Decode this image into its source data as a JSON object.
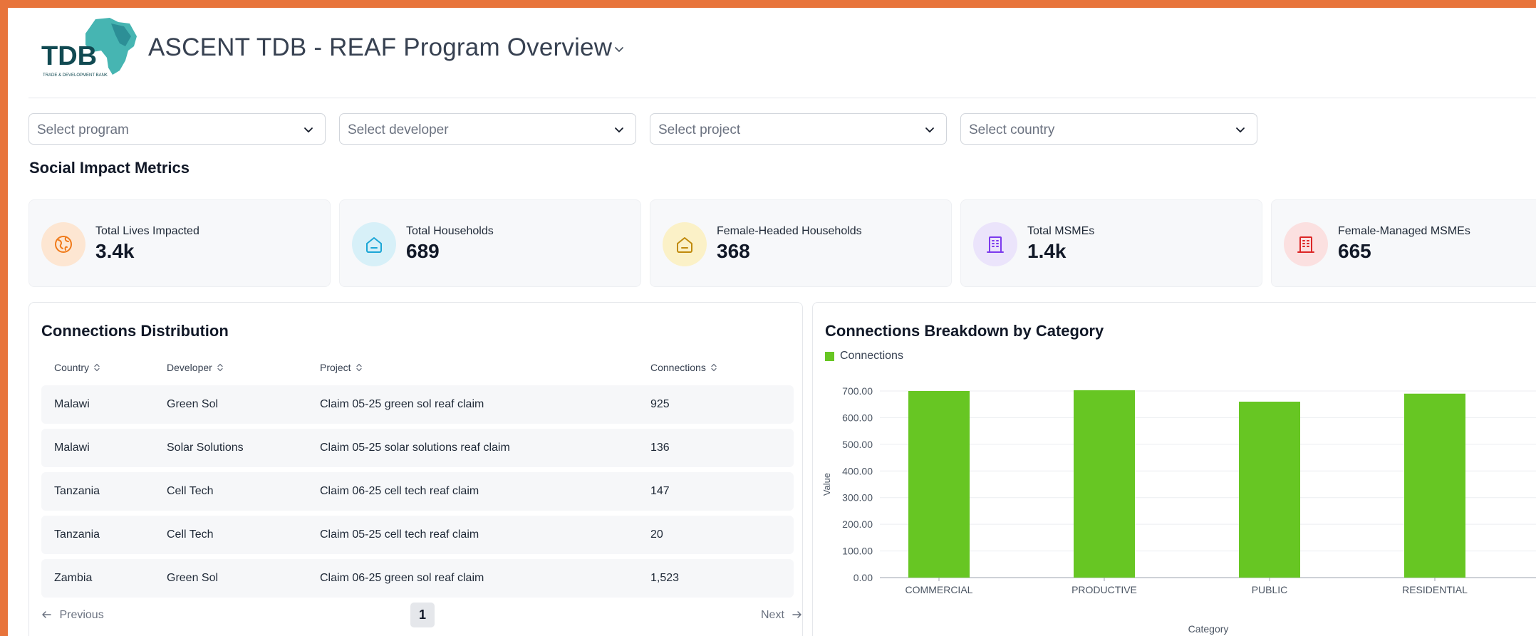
{
  "header": {
    "logo_text": "TDB",
    "logo_subtext": "TRADE & DEVELOPMENT BANK",
    "title": "ASCENT TDB - REAF Program Overview"
  },
  "filters": [
    {
      "placeholder": "Select program"
    },
    {
      "placeholder": "Select developer"
    },
    {
      "placeholder": "Select project"
    },
    {
      "placeholder": "Select country"
    }
  ],
  "section_title": "Social Impact Metrics",
  "metrics": [
    {
      "label": "Total Lives Impacted",
      "value": "3.4k",
      "icon": "globe-icon",
      "bg": "#fde6d2",
      "color": "#f07a1a"
    },
    {
      "label": "Total Households",
      "value": "689",
      "icon": "home-icon",
      "bg": "#d7f0f8",
      "color": "#1ba6d6"
    },
    {
      "label": "Female-Headed Households",
      "value": "368",
      "icon": "home-icon",
      "bg": "#fbf1c7",
      "color": "#c08a0c"
    },
    {
      "label": "Total MSMEs",
      "value": "1.4k",
      "icon": "building-icon",
      "bg": "#ebe4fb",
      "color": "#7c3aed"
    },
    {
      "label": "Female-Managed MSMEs",
      "value": "665",
      "icon": "building-icon",
      "bg": "#fbe0e0",
      "color": "#dc2626"
    }
  ],
  "connections_table": {
    "title": "Connections Distribution",
    "columns": [
      "Country",
      "Developer",
      "Project",
      "Connections"
    ],
    "rows": [
      [
        "Malawi",
        "Green Sol",
        "Claim 05-25 green sol reaf claim",
        "925"
      ],
      [
        "Malawi",
        "Solar Solutions",
        "Claim 05-25 solar solutions reaf claim",
        "136"
      ],
      [
        "Tanzania",
        "Cell Tech",
        "Claim 06-25 cell tech reaf claim",
        "147"
      ],
      [
        "Tanzania",
        "Cell Tech",
        "Claim 05-25 cell tech reaf claim",
        "20"
      ],
      [
        "Zambia",
        "Green Sol",
        "Claim 06-25 green sol reaf claim",
        "1,523"
      ]
    ],
    "pager": {
      "prev": "Previous",
      "next": "Next",
      "page": "1"
    }
  },
  "chart_data": {
    "type": "bar",
    "title": "Connections Breakdown by Category",
    "categories": [
      "COMMERCIAL",
      "PRODUCTIVE",
      "PUBLIC",
      "RESIDENTIAL"
    ],
    "series": [
      {
        "name": "Connections",
        "values": [
          700,
          703,
          660,
          690
        ]
      }
    ],
    "xlabel": "Category",
    "ylabel": "Value",
    "ylim": [
      0,
      700
    ],
    "yticks": [
      "0.00",
      "100.00",
      "200.00",
      "300.00",
      "400.00",
      "500.00",
      "600.00",
      "700.00"
    ],
    "grid": true,
    "legend": "top-left",
    "bar_color": "#67c623"
  }
}
